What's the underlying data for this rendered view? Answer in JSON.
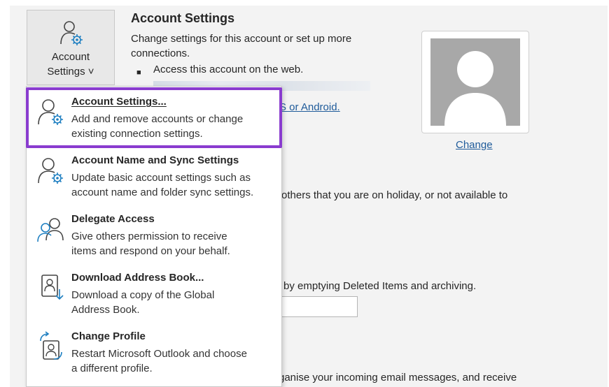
{
  "account_button": {
    "line1": "Account",
    "line2": "Settings ˅"
  },
  "section": {
    "title": "Account Settings",
    "description_line1": "Change settings for this account or set up more",
    "description_line2": "connections.",
    "bullet": "Access this account on the web.",
    "ios_link": "S or Android."
  },
  "profile": {
    "change_label": "Change"
  },
  "background": {
    "holiday_text": "others that you are on holiday, or not available to",
    "mailbox_text": "ox by emptying Deleted Items and archiving.",
    "rules_text": "ganise your incoming email messages, and receive"
  },
  "menu": {
    "items": [
      {
        "title": "Account Settings...",
        "desc1": "Add and remove accounts or change",
        "desc2": "existing connection settings.",
        "icon": "account-settings-icon"
      },
      {
        "title": "Account Name and Sync Settings",
        "desc1": "Update basic account settings such as",
        "desc2": "account name and folder sync settings.",
        "icon": "account-sync-icon"
      },
      {
        "title": "Delegate Access",
        "desc1": "Give others permission to receive",
        "desc2": "items and respond on your behalf.",
        "icon": "delegate-icon"
      },
      {
        "title": "Download Address Book...",
        "desc1": "Download a copy of the Global",
        "desc2": "Address Book.",
        "icon": "address-book-icon"
      },
      {
        "title": "Change Profile",
        "desc1": "Restart Microsoft Outlook and choose",
        "desc2": "a different profile.",
        "icon": "change-profile-icon"
      }
    ]
  },
  "colors": {
    "highlight": "#8a3ccf",
    "link": "#1f5b9a",
    "icon_accent": "#1e7fc1"
  }
}
